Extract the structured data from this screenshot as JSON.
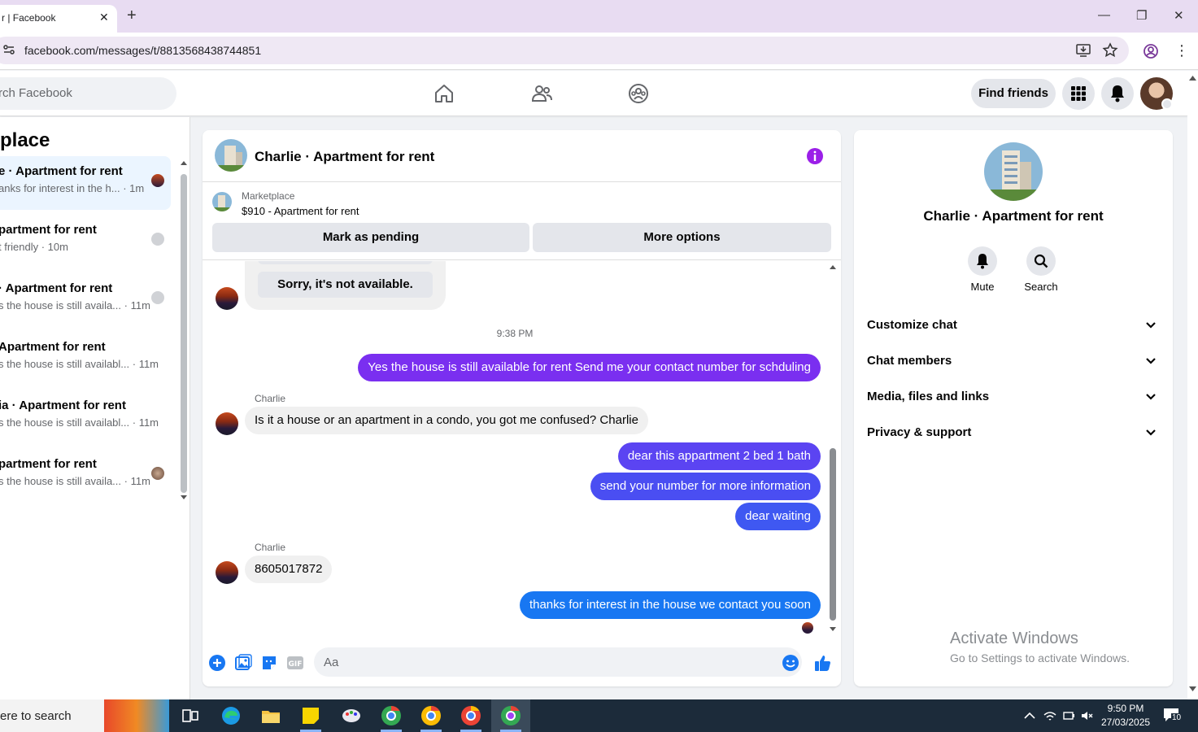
{
  "browser": {
    "tab_title": "r | Facebook",
    "url": "facebook.com/messages/t/8813568438744851"
  },
  "header": {
    "search_placeholder": "rch Facebook",
    "find_friends": "Find friends"
  },
  "sidebar": {
    "title": "tplace",
    "chats": [
      {
        "name": "e · Apartment for rent",
        "snippet": "anks for interest in the h... · 1m",
        "active": true
      },
      {
        "name": "partment for rent",
        "snippet": "t friendly · 10m",
        "active": false
      },
      {
        "name": "· Apartment for rent",
        "snippet": "s the house is still availa... · 11m",
        "active": false
      },
      {
        "name": "Apartment for rent",
        "snippet": "s the house is still availabl... · 11m",
        "active": false
      },
      {
        "name": "ia · Apartment for rent",
        "snippet": "s the house is still availabl... · 11m",
        "active": false
      },
      {
        "name": "partment for rent",
        "snippet": "s the house is still availa... · 11m",
        "active": false
      }
    ]
  },
  "conversation": {
    "title": "Charlie · Apartment for rent",
    "listing_label": "Marketplace",
    "listing_price": "$910 - Apartment for rent",
    "mark_pending": "Mark as pending",
    "more_options": "More options",
    "reply_card_text": "Sorry, it's not available.",
    "timestamp": "9:38 PM",
    "messages": [
      {
        "side": "right",
        "text": "Yes the house is still available for rent Send me your contact number for schduling",
        "color": "#7a2ff0"
      },
      {
        "side": "left",
        "sender": "Charlie",
        "text": "Is it a house or an apartment in a condo, you got me confused? Charlie"
      },
      {
        "side": "right",
        "text": "dear this appartment 2 bed 1 bath",
        "color": "#5b44f2"
      },
      {
        "side": "right",
        "text": "send your number for more information",
        "color": "#4a4ef2"
      },
      {
        "side": "right",
        "text": "dear waiting",
        "color": "#3f58f2"
      },
      {
        "side": "left",
        "sender": "Charlie",
        "text": "8605017872"
      },
      {
        "side": "right",
        "text": "thanks for interest in the house we contact you soon",
        "color": "#1877f2"
      }
    ],
    "input_placeholder": "Aa"
  },
  "info_panel": {
    "name": "Charlie · Apartment for rent",
    "mute_label": "Mute",
    "search_label": "Search",
    "rows": [
      "Customize chat",
      "Chat members",
      "Media, files and links",
      "Privacy & support"
    ],
    "watermark_title": "Activate Windows",
    "watermark_sub": "Go to Settings to activate Windows."
  },
  "taskbar": {
    "search_text": "ere to search",
    "time": "9:50 PM",
    "date": "27/03/2025",
    "notification_count": "10"
  },
  "colors": {
    "accent": "#1877f2",
    "purple": "#a033ff",
    "info_purple": "#9b1fe8"
  }
}
